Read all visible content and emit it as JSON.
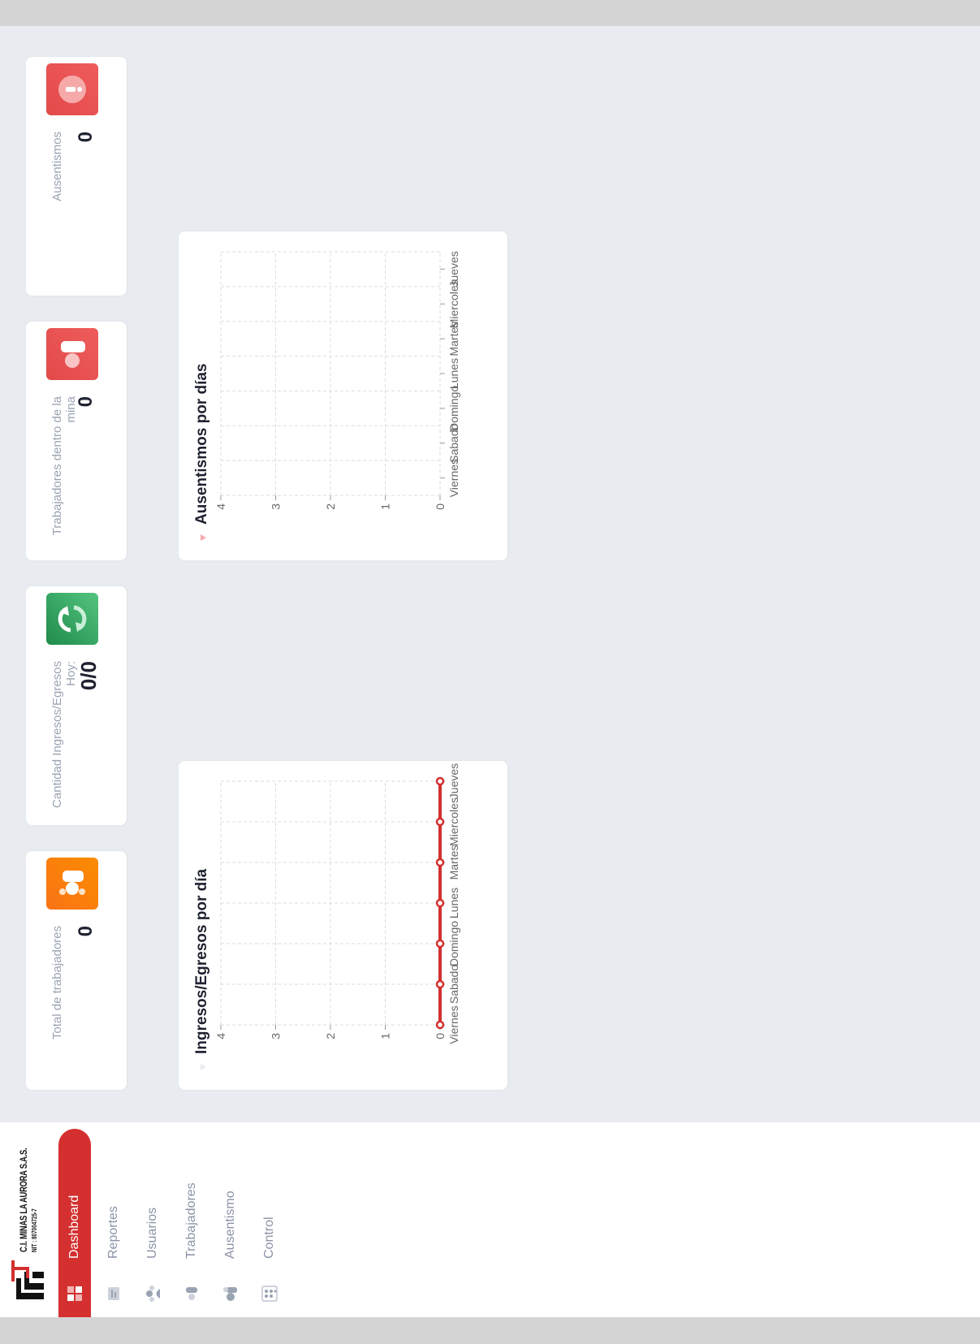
{
  "company": {
    "name": "C.I. MINAS LA AURORA S.A.S.",
    "nit": "NIT : 807004725-7"
  },
  "nav": {
    "items": [
      {
        "label": "Dashboard",
        "icon": "dashboard-icon",
        "active": true
      },
      {
        "label": "Reportes",
        "icon": "reports-icon",
        "active": false
      },
      {
        "label": "Usuarios",
        "icon": "users-icon",
        "active": false
      },
      {
        "label": "Trabajadores",
        "icon": "workers-icon",
        "active": false
      },
      {
        "label": "Ausentismo",
        "icon": "absence-icon",
        "active": false
      },
      {
        "label": "Control",
        "icon": "control-icon",
        "active": false
      }
    ],
    "active_color": "#d3302f"
  },
  "stats": [
    {
      "label": "Total de trabajadores",
      "value": "0",
      "icon": "workers-icon",
      "color": "#f97316"
    },
    {
      "label": "Cantidad Ingresos/Egresos Hoy:",
      "value": "0/0",
      "icon": "refresh-icon",
      "color": "#22a05a"
    },
    {
      "label": "Trabajadores dentro de la mina",
      "value": "0",
      "icon": "worker-inside-icon",
      "color": "#e24a4a"
    },
    {
      "label": "Ausentismos",
      "value": "0",
      "icon": "alert-icon",
      "color": "#e24a4a"
    }
  ],
  "chart_data": [
    {
      "type": "line",
      "title": "Ingresos/Egresos por día",
      "categories": [
        "Viernes",
        "Sabado",
        "Domingo",
        "Lunes",
        "Martes",
        "Miercoles",
        "Jueves"
      ],
      "series": [
        {
          "values": [
            0,
            0,
            0,
            0,
            0,
            0,
            0
          ],
          "color": "#d3302f"
        }
      ],
      "yticks": [
        "0",
        "1",
        "2",
        "3",
        "4"
      ],
      "ylim": [
        0,
        4
      ],
      "grid": true
    },
    {
      "type": "bar",
      "title": "Ausentismos por días",
      "categories": [
        "Viernes",
        "Sabado",
        "Domingo",
        "Lunes",
        "Martes",
        "Miercoles",
        "Jueves"
      ],
      "series": [
        {
          "values": [
            0,
            0,
            0,
            0,
            0,
            0,
            0
          ],
          "color": "#e24a4a"
        }
      ],
      "yticks": [
        "0",
        "1",
        "2",
        "3",
        "4"
      ],
      "ylim": [
        0,
        4
      ],
      "grid": true
    }
  ]
}
